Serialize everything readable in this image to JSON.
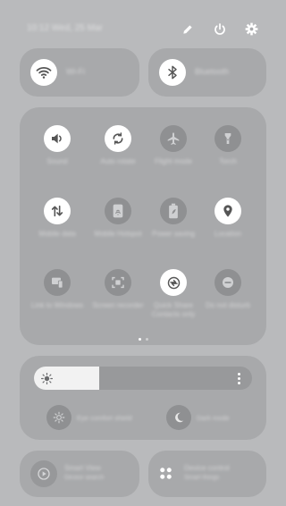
{
  "status": {
    "date_text": "10:12 Wed, 25 Mar"
  },
  "header_icons": [
    {
      "name": "edit-icon",
      "color": "#ffffff"
    },
    {
      "name": "power-icon",
      "color": "#ffffff"
    },
    {
      "name": "settings-icon",
      "color": "#ffffff"
    }
  ],
  "top_tiles": {
    "wifi": {
      "label": "Wi-Fi",
      "state": "on"
    },
    "bluetooth": {
      "label": "Bluetooth",
      "state": "on"
    }
  },
  "toggles": [
    {
      "label": "Sound",
      "icon": "sound-icon",
      "state": "on"
    },
    {
      "label": "Auto rotate",
      "icon": "auto-rotate-icon",
      "state": "on"
    },
    {
      "label": "Flight mode",
      "icon": "airplane-icon",
      "state": "off"
    },
    {
      "label": "Torch",
      "icon": "flashlight-icon",
      "state": "off"
    },
    {
      "label": "Mobile data",
      "icon": "mobile-data-icon",
      "state": "on"
    },
    {
      "label": "Mobile Hotspot",
      "icon": "hotspot-icon",
      "state": "off"
    },
    {
      "label": "Power saving",
      "icon": "battery-saver-icon",
      "state": "off"
    },
    {
      "label": "Location",
      "icon": "location-icon",
      "state": "on"
    },
    {
      "label": "Link to Windows",
      "icon": "link-windows-icon",
      "state": "off"
    },
    {
      "label": "Screen recorder",
      "icon": "screen-recorder-icon",
      "state": "off"
    },
    {
      "label": "Quick Share Contacts only",
      "icon": "quick-share-icon",
      "state": "on"
    },
    {
      "label": "Do not disturb",
      "icon": "do-not-disturb-icon",
      "state": "off"
    }
  ],
  "page_indicator": {
    "pages": 2,
    "current": 1
  },
  "brightness": {
    "level": 0.3
  },
  "display_modes": [
    {
      "label": "Eye comfort shield",
      "icon": "eye-comfort-icon"
    },
    {
      "label": "Dark mode",
      "icon": "dark-mode-icon"
    }
  ],
  "bottom_tiles": [
    {
      "label": "Smart View",
      "sublabel": "Device search",
      "icon": "smart-view-icon"
    },
    {
      "label": "Device control",
      "sublabel": "Smart things",
      "icon": "device-control-icon"
    }
  ],
  "colors": {
    "panel": "#a8a9ab",
    "active_icon_bg": "#ffffff",
    "inactive_icon_bg": "#8f9092"
  }
}
